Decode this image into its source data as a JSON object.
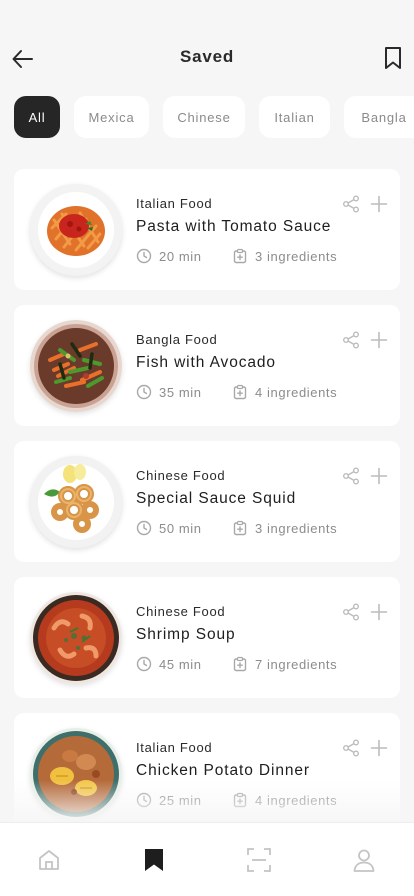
{
  "header": {
    "title": "Saved",
    "back_icon": "arrow-left-icon",
    "bookmark_icon": "bookmark-icon"
  },
  "filters": [
    {
      "label": "All",
      "active": true
    },
    {
      "label": "Mexica",
      "active": false
    },
    {
      "label": "Chinese",
      "active": false
    },
    {
      "label": "Italian",
      "active": false
    },
    {
      "label": "Bangla",
      "active": false
    }
  ],
  "recipes": [
    {
      "category": "Italian Food",
      "title": "Pasta with Tomato Sauce",
      "time": "20 min",
      "ingredients": "3 ingredients",
      "image": "pasta-dish"
    },
    {
      "category": "Bangla Food",
      "title": "Fish with Avocado",
      "time": "35 min",
      "ingredients": "4 ingredients",
      "image": "vegetable-dish"
    },
    {
      "category": "Chinese Food",
      "title": "Special Sauce Squid",
      "time": "50 min",
      "ingredients": "3 ingredients",
      "image": "squid-rings-dish"
    },
    {
      "category": "Chinese Food",
      "title": "Shrimp Soup",
      "time": "45 min",
      "ingredients": "7 ingredients",
      "image": "shrimp-soup-dish"
    },
    {
      "category": "Italian Food",
      "title": "Chicken Potato Dinner",
      "time": "25 min",
      "ingredients": "4 ingredients",
      "image": "chicken-potato-dish"
    }
  ],
  "bottom_nav": [
    {
      "name": "home",
      "icon": "home-icon",
      "active": false
    },
    {
      "name": "saved",
      "icon": "bookmark-filled-icon",
      "active": true
    },
    {
      "name": "scan",
      "icon": "scan-icon",
      "active": false
    },
    {
      "name": "profile",
      "icon": "user-icon",
      "active": false
    }
  ],
  "colors": {
    "background": "#f6f6f6",
    "card": "#ffffff",
    "active_chip": "#262626",
    "muted_text": "#8c8c8c",
    "icon": "#bcbcbc"
  }
}
